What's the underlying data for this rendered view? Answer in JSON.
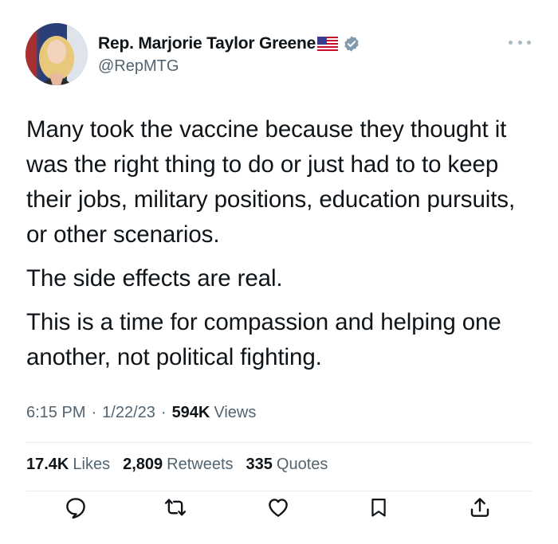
{
  "author": {
    "display_name": "Rep. Marjorie Taylor Greene",
    "handle": "@RepMTG",
    "flag_icon": "us-flag-icon",
    "verified_icon": "verified-badge-icon"
  },
  "tweet": {
    "paragraphs": [
      "Many took the vaccine because they thought it was the right thing to do or just had to to keep their jobs, military positions, education pursuits, or other scenarios.",
      "The side effects are real.",
      "This is a time for compassion and helping one another, not political fighting."
    ]
  },
  "meta": {
    "time": "6:15 PM",
    "separator": "·",
    "date": "1/22/23",
    "views_count": "594K",
    "views_label": "Views"
  },
  "stats": {
    "likes_count": "17.4K",
    "likes_label": "Likes",
    "retweets_count": "2,809",
    "retweets_label": "Retweets",
    "quotes_count": "335",
    "quotes_label": "Quotes"
  },
  "actions": [
    {
      "icon": "reply-icon"
    },
    {
      "icon": "retweet-icon"
    },
    {
      "icon": "like-icon"
    },
    {
      "icon": "bookmark-icon"
    },
    {
      "icon": "share-icon"
    }
  ],
  "colors": {
    "text": "#0f1419",
    "secondary": "#536471",
    "verified": "#829aab",
    "divider": "#e6ecf0"
  }
}
